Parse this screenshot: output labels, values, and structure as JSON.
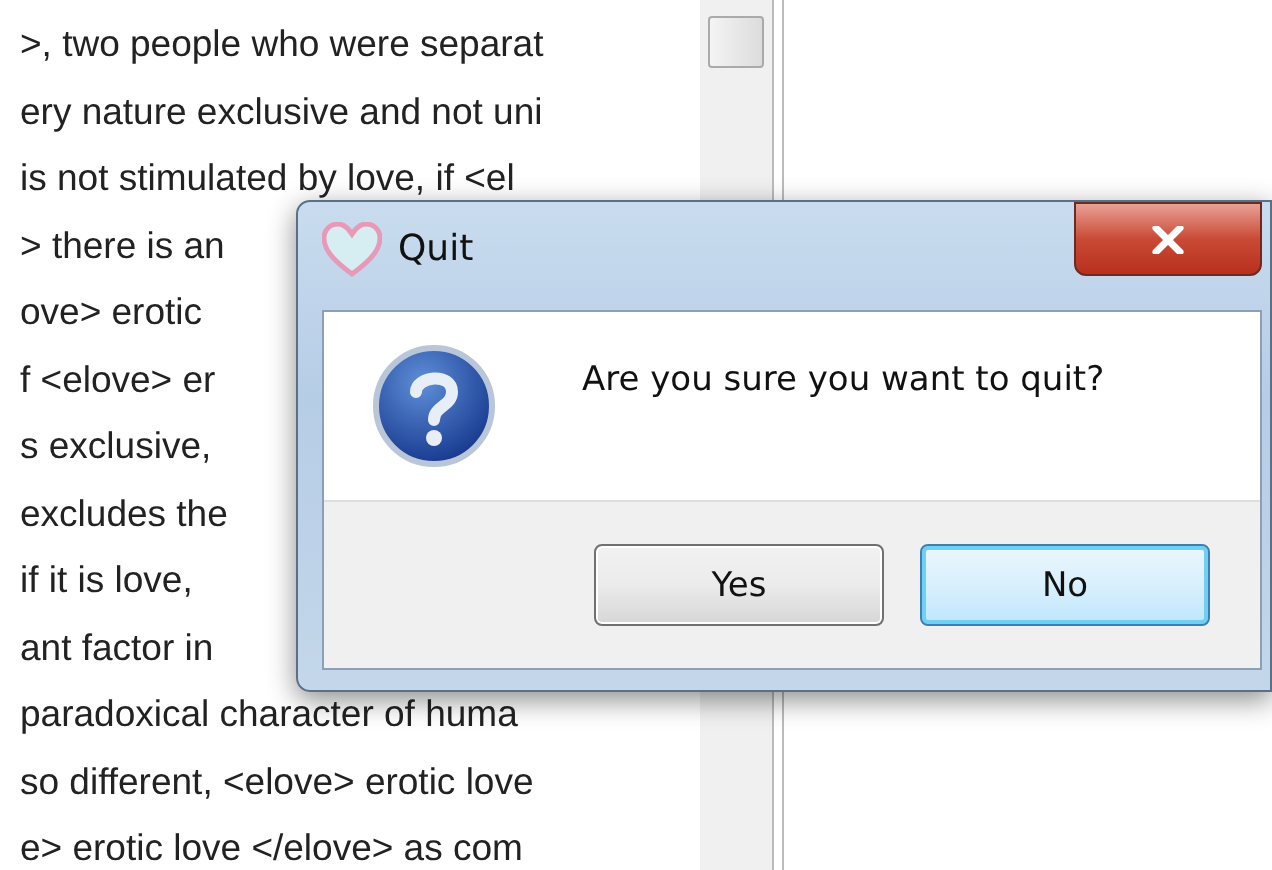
{
  "document": {
    "lines": [
      ">, two people who were separat",
      "ery nature exclusive and not uni",
      "is not stimulated by love, if <el",
      "> there is an",
      "ove> erotic",
      "f <elove> er",
      "s exclusive,",
      "excludes the",
      "if it is love,",
      "ant factor in",
      "paradoxical character of huma",
      "so different, <elove> erotic love",
      "e> erotic love </elove> as com"
    ]
  },
  "dialog": {
    "title": "Quit",
    "message": "Are you sure you want to quit?",
    "buttons": [
      {
        "label": "Yes",
        "focused": false
      },
      {
        "label": "No",
        "focused": true
      }
    ]
  }
}
